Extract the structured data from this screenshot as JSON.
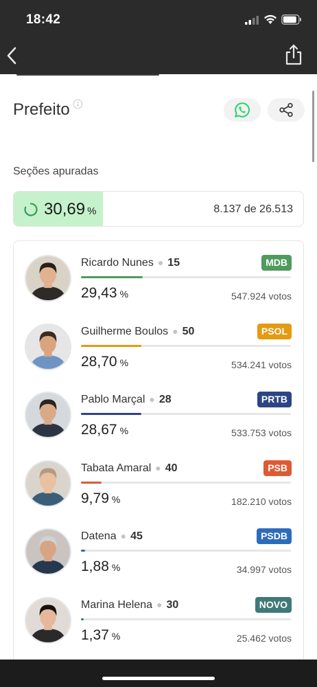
{
  "status_bar": {
    "time": "18:42"
  },
  "header": {
    "title": "Prefeito"
  },
  "sections": {
    "label": "Seções apuradas",
    "percent": "30,69",
    "percent_unit": "%",
    "percent_value": 0.3069,
    "count_text": "8.137 de 26.513"
  },
  "candidates": [
    {
      "name": "Ricardo Nunes",
      "number": "15",
      "party": "MDB",
      "party_color": "#4f9a5c",
      "percent": "29,43",
      "percent_unit": "%",
      "share": 0.2943,
      "votes": "547.924 votos"
    },
    {
      "name": "Guilherme Boulos",
      "number": "50",
      "party": "PSOL",
      "party_color": "#e49a12",
      "percent": "28,70",
      "percent_unit": "%",
      "share": 0.287,
      "votes": "534.241 votos"
    },
    {
      "name": "Pablo Marçal",
      "number": "28",
      "party": "PRTB",
      "party_color": "#2c4585",
      "percent": "28,67",
      "percent_unit": "%",
      "share": 0.2867,
      "votes": "533.753 votos"
    },
    {
      "name": "Tabata Amaral",
      "number": "40",
      "party": "PSB",
      "party_color": "#dd5a34",
      "percent": "9,79",
      "percent_unit": "%",
      "share": 0.0979,
      "votes": "182.210 votos"
    },
    {
      "name": "Datena",
      "number": "45",
      "party": "PSDB",
      "party_color": "#2e6cba",
      "percent": "1,88",
      "percent_unit": "%",
      "share": 0.0188,
      "votes": "34.997 votos"
    },
    {
      "name": "Marina Helena",
      "number": "30",
      "party": "NOVO",
      "party_color": "#3f7a78",
      "percent": "1,37",
      "percent_unit": "%",
      "share": 0.0137,
      "votes": "25.462 votos"
    }
  ],
  "colors": {
    "sections_fill": "#c5f2cb",
    "spinner": "#2f9e55",
    "whatsapp": "#25d366"
  },
  "icons": [
    "signal-icon",
    "wifi-icon",
    "battery-icon",
    "back-arrow-icon",
    "share-icon",
    "info-icon",
    "whatsapp-icon",
    "share-nodes-icon",
    "spinner-icon"
  ]
}
